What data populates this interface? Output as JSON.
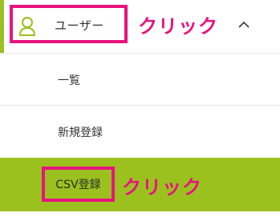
{
  "menu": {
    "parent": {
      "label": "ユーザー",
      "icon": "user-icon",
      "expand_icon": "chevron-up-icon"
    },
    "items": [
      {
        "label": "一覧"
      },
      {
        "label": "新規登録"
      },
      {
        "label": "CSV登録",
        "active": true
      }
    ]
  },
  "annotations": {
    "click_user": "クリック",
    "click_csv": "クリック"
  },
  "colors": {
    "accent_green": "#9bc11e",
    "highlight_pink": "#e8137f"
  }
}
